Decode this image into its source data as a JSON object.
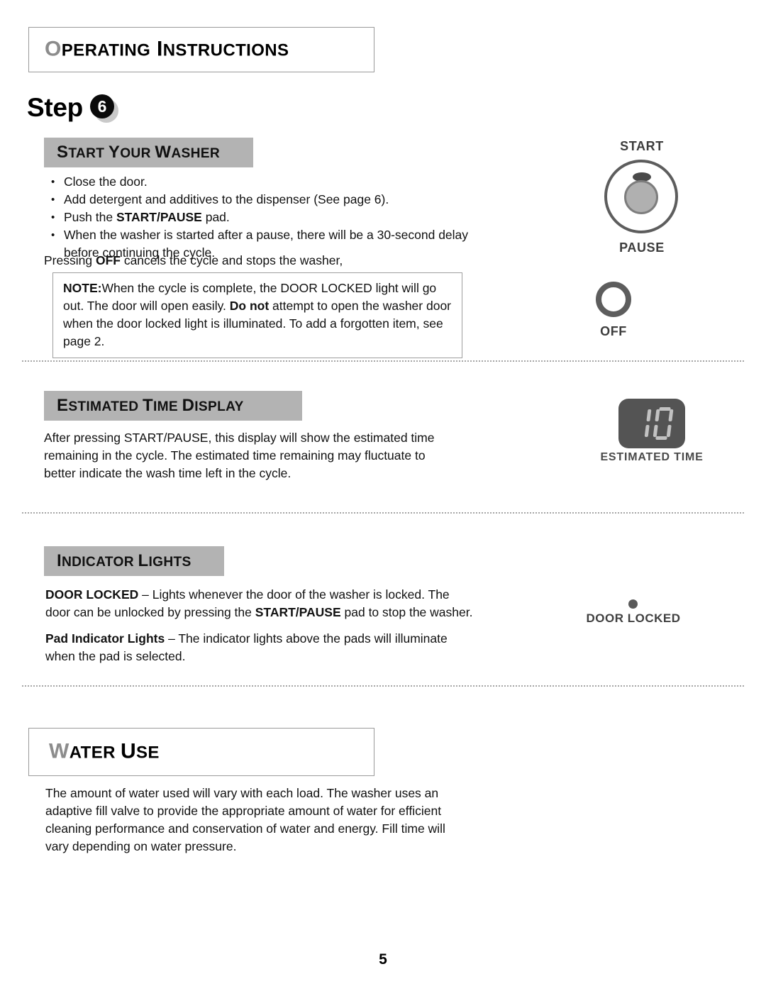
{
  "page": {
    "header_title_initial": "O",
    "header_title_rest": "PERATING",
    "header_title_word2_initial": "I",
    "header_title_word2_rest": "NSTRUCTIONS",
    "step_word": "Step",
    "step_number": "6",
    "page_number": "5"
  },
  "sections": {
    "start_your_washer": {
      "heading_parts": [
        "S",
        "TART ",
        "Y",
        "OUR ",
        "W",
        "ASHER"
      ],
      "bullets": [
        "Close the door.",
        "Add detergent and additives to the dispenser (See page 6).",
        "Push the START/PAUSE pad.",
        "When the washer is started after a pause, there will be a 30-second delay before continuing the cycle."
      ],
      "bullet3_pre": "Push the ",
      "bullet3_bold": "START/PAUSE",
      "bullet3_post": " pad.",
      "bullet4_line1": "When the washer is started after a pause, there will be a 30-second delay",
      "bullet4_line2": "before continuing the cycle.",
      "closing_pre": "Pressing ",
      "closing_bold": "OFF",
      "closing_post": " cancels the cycle and stops the washer,",
      "note": {
        "label": "NOTE:",
        "part1": "When the cycle is complete, the DOOR LOCKED light will go out. The door will open easily. ",
        "bold2": "Do not",
        "part2": " attempt to open the washer door when the door locked light is illuminated. To add a forgotten item, see page 2."
      }
    },
    "estimated_time_display": {
      "heading_parts": [
        "E",
        "STIMATED ",
        "T",
        "IME ",
        "D",
        "ISPLAY"
      ],
      "body": "After pressing START/PAUSE, this display will show the estimated time remaining in the cycle. The estimated time remaining may fluctuate to better indicate the wash time left in the cycle."
    },
    "indicator_lights": {
      "heading_parts": [
        "I",
        "NDICATOR ",
        "L",
        "IGHTS"
      ],
      "para1_bold": "DOOR LOCKED",
      "para1_mid": " – Lights whenever the door of the washer is locked. The door can be unlocked by pressing the ",
      "para1_bold2": "START/PAUSE",
      "para1_end": " pad to stop the washer.",
      "para2_bold": "Pad Indicator Lights",
      "para2_text": " – The indicator lights above the pads will illuminate when the pad is selected."
    },
    "water_use": {
      "heading_initial": "W",
      "heading_rest": "ATER ",
      "heading_initial2": "U",
      "heading_rest2": "SE",
      "body": "The amount of water used will vary with each load. The washer uses an adaptive fill valve to provide the appropriate amount of water for efficient cleaning performance and conservation of water and energy. Fill time will vary depending on water pressure."
    }
  },
  "controls": {
    "start_label": "START",
    "pause_label": "PAUSE",
    "off_label": "OFF",
    "estimated_time_label": "ESTIMATED TIME",
    "display_value": "10",
    "door_locked_label": "DOOR LOCKED"
  },
  "colors": {
    "heading_bar": "#b3b3b3",
    "box_border": "#9a9a9a",
    "control_gray": "#5d5d5d",
    "display_bg": "#545454",
    "segment": "#c2c2c2",
    "initial_cap_gray": "#8c8c8c"
  }
}
